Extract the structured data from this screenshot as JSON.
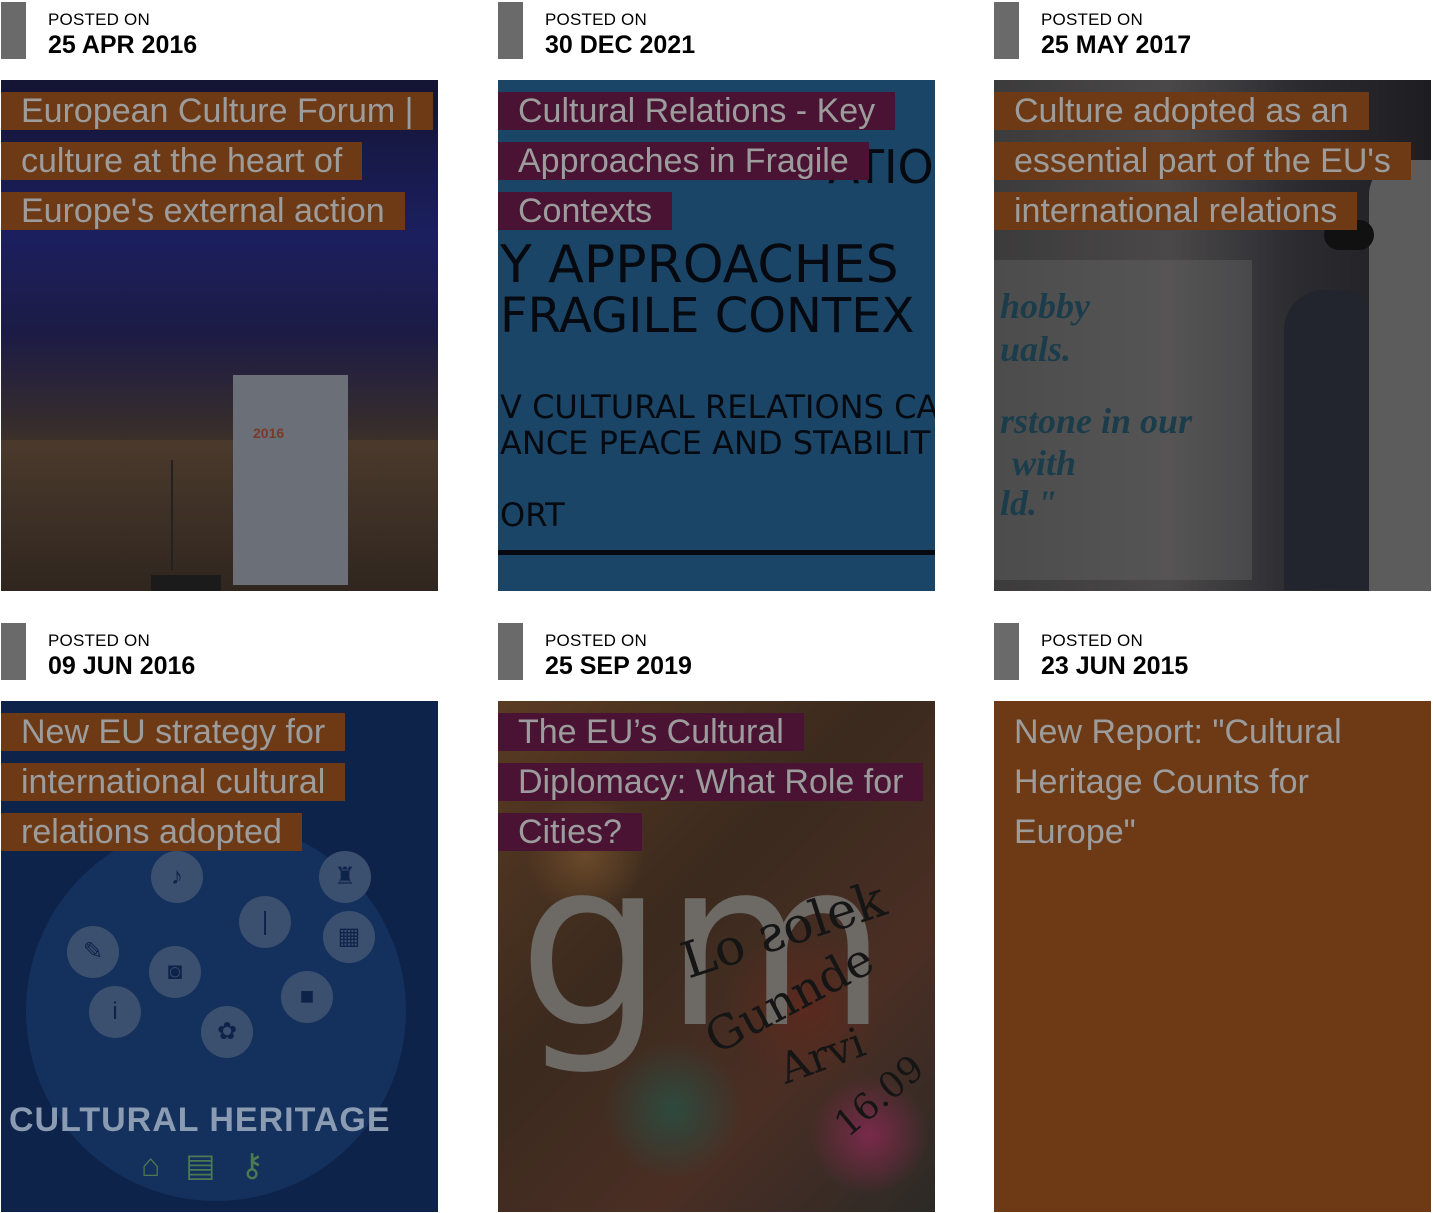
{
  "posts": [
    {
      "posted_on_label": "POSTED ON",
      "date": "25 APR 2016",
      "title": "European Culture Forum | culture at the heart of Europe's external action",
      "title_color": "#6e3a16",
      "image_text": "2016"
    },
    {
      "posted_on_label": "POSTED ON",
      "date": "30 DEC 2021",
      "title": "Cultural Relations - Key Approaches in Fragile Contexts",
      "title_color": "#4a1334",
      "image_lines": [
        "ATIO",
        "Y APPROACHES",
        "FRAGILE CONTEX",
        "V CULTURAL RELATIONS CA",
        "ANCE PEACE AND STABILIT",
        "ORT"
      ]
    },
    {
      "posted_on_label": "POSTED ON",
      "date": "25 MAY 2017",
      "title": "Culture adopted as an essential part of the EU's international relations",
      "title_color": "#6e3a16",
      "image_lines": [
        "hobby",
        "uals.",
        "rstone in our",
        "with",
        "ld.\""
      ]
    },
    {
      "posted_on_label": "POSTED ON",
      "date": "09 JUN 2016",
      "title": "New EU strategy for international cultural relations adopted",
      "title_color": "#6e3a16",
      "image_text": "CULTURAL HERITAGE"
    },
    {
      "posted_on_label": "POSTED ON",
      "date": "25 SEP 2019",
      "title": "The EU’s Cultural Diplomacy: What Role for Cities?",
      "title_color": "#4a1334",
      "image_lines": [
        "Lo ƨolek",
        "Gunnde",
        "Arvi",
        "16.09"
      ]
    },
    {
      "posted_on_label": "POSTED ON",
      "date": "23 JUN 2015",
      "title": "New Report: \"Cultural Heritage Counts for Europe\"",
      "title_color": "#6e3a16"
    }
  ]
}
